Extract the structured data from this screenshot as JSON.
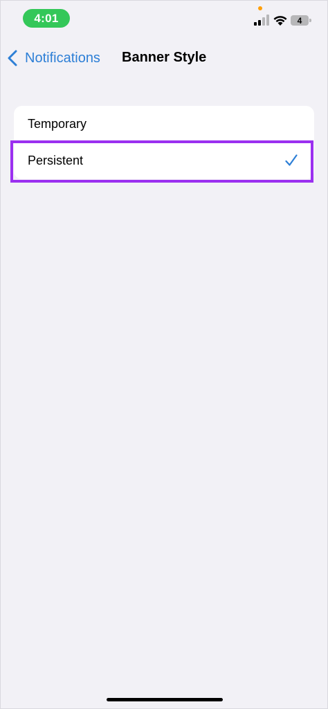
{
  "status_bar": {
    "time": "4:01",
    "battery_level": "4",
    "signal_icon": "cellular-signal-icon",
    "wifi_icon": "wifi-icon",
    "battery_icon": "battery-icon",
    "time_pill_color": "#34c759",
    "mic_indicator_color": "#ff9f0a"
  },
  "nav": {
    "back_label": "Notifications",
    "back_icon": "chevron-left-icon",
    "title": "Banner Style",
    "accent_color": "#2d7fd6"
  },
  "options": [
    {
      "label": "Temporary",
      "selected": false
    },
    {
      "label": "Persistent",
      "selected": true
    }
  ],
  "selection_icon": "checkmark-icon",
  "highlight_color": "#9b30f0"
}
